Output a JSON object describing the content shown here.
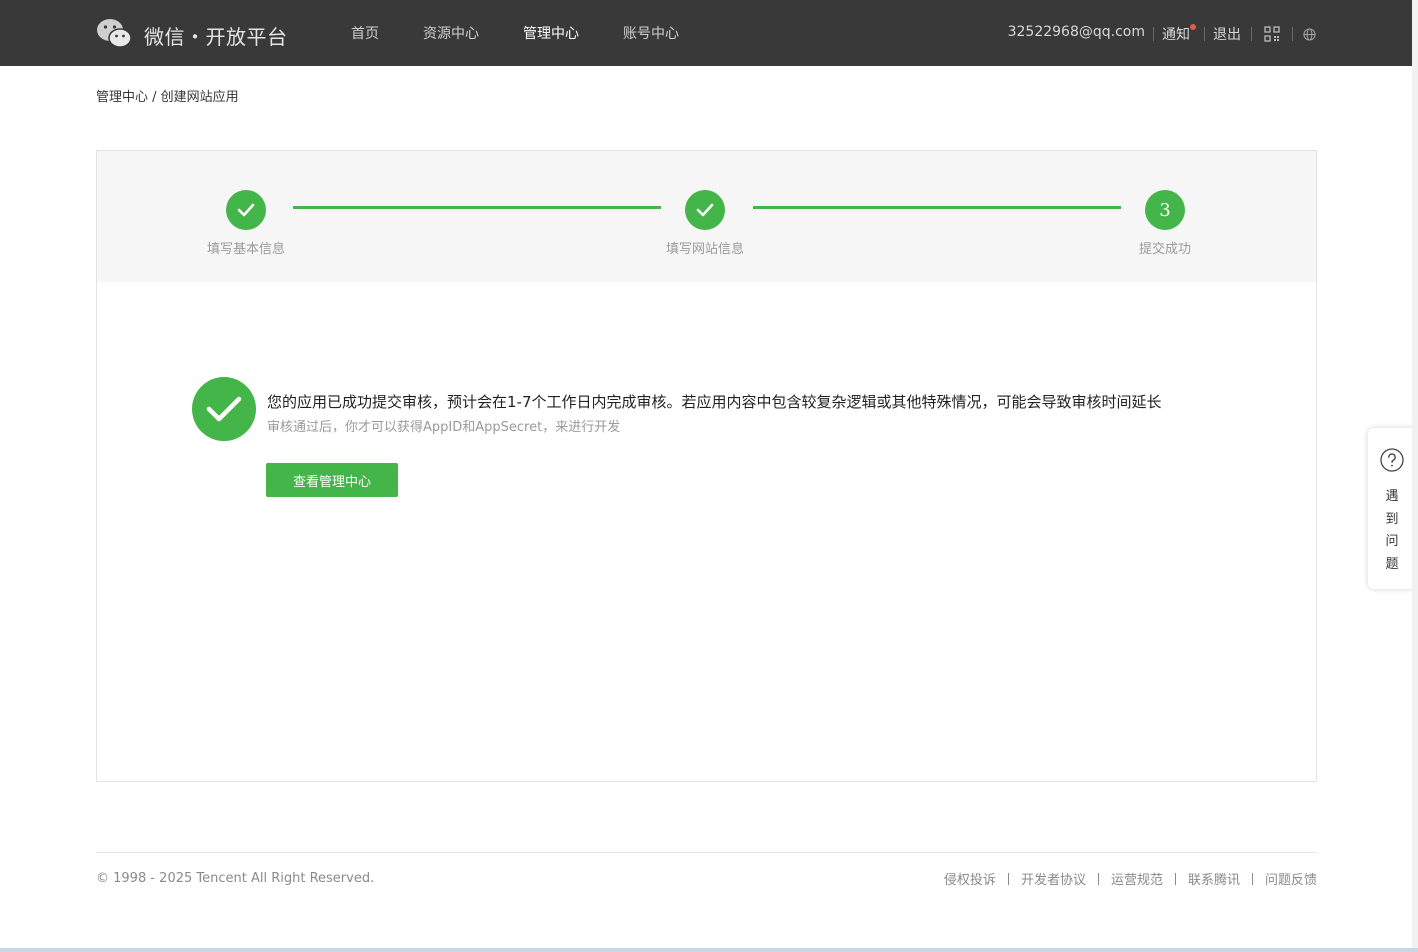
{
  "header": {
    "logo_text": "微信・开放平台",
    "nav": [
      {
        "label": "首页",
        "active": false
      },
      {
        "label": "资源中心",
        "active": false
      },
      {
        "label": "管理中心",
        "active": true
      },
      {
        "label": "账号中心",
        "active": false
      }
    ],
    "email": "32522968@qq.com",
    "notify_label": "通知",
    "logout_label": "退出",
    "icons": [
      "qrcode-icon",
      "globe-icon"
    ]
  },
  "breadcrumb": {
    "parent": "管理中心",
    "separator": " / ",
    "current": "创建网站应用"
  },
  "steps": [
    {
      "label": "填写基本信息",
      "state": "done"
    },
    {
      "label": "填写网站信息",
      "state": "done"
    },
    {
      "label": "提交成功",
      "state": "current",
      "number": "3"
    }
  ],
  "success": {
    "message": "您的应用已成功提交审核，预计会在1-7个工作日内完成审核。若应用内容中包含较复杂逻辑或其他特殊情况，可能会导致审核时间延长",
    "sub_message": "审核通过后，你才可以获得AppID和AppSecret，来进行开发",
    "button_label": "查看管理中心"
  },
  "help": {
    "label": "遇到问题",
    "chars": [
      "遇",
      "到",
      "问",
      "题"
    ]
  },
  "footer": {
    "copyright": "© 1998 - 2025 Tencent All Right Reserved.",
    "links": [
      "侵权投诉",
      "开发者协议",
      "运营规范",
      "联系腾讯",
      "问题反馈"
    ]
  },
  "colors": {
    "header_bg": "#393939",
    "accent_green": "#44b549",
    "notify_dot": "#e05a4f"
  }
}
